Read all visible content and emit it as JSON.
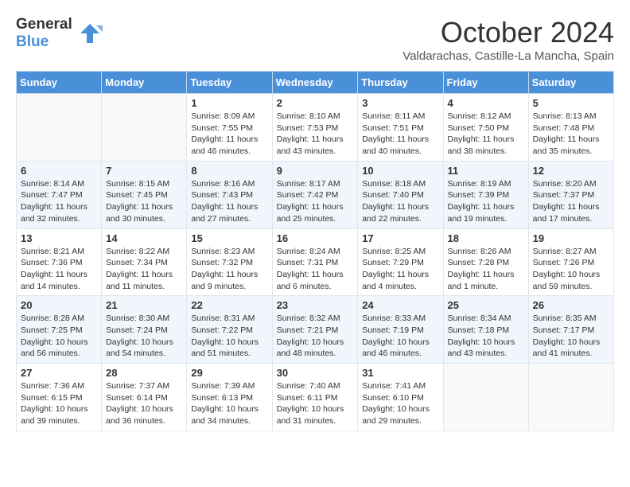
{
  "header": {
    "logo_line1": "General",
    "logo_line2": "Blue",
    "month": "October 2024",
    "location": "Valdarachas, Castille-La Mancha, Spain"
  },
  "weekdays": [
    "Sunday",
    "Monday",
    "Tuesday",
    "Wednesday",
    "Thursday",
    "Friday",
    "Saturday"
  ],
  "weeks": [
    [
      {
        "day": "",
        "info": ""
      },
      {
        "day": "",
        "info": ""
      },
      {
        "day": "1",
        "info": "Sunrise: 8:09 AM\nSunset: 7:55 PM\nDaylight: 11 hours and 46 minutes."
      },
      {
        "day": "2",
        "info": "Sunrise: 8:10 AM\nSunset: 7:53 PM\nDaylight: 11 hours and 43 minutes."
      },
      {
        "day": "3",
        "info": "Sunrise: 8:11 AM\nSunset: 7:51 PM\nDaylight: 11 hours and 40 minutes."
      },
      {
        "day": "4",
        "info": "Sunrise: 8:12 AM\nSunset: 7:50 PM\nDaylight: 11 hours and 38 minutes."
      },
      {
        "day": "5",
        "info": "Sunrise: 8:13 AM\nSunset: 7:48 PM\nDaylight: 11 hours and 35 minutes."
      }
    ],
    [
      {
        "day": "6",
        "info": "Sunrise: 8:14 AM\nSunset: 7:47 PM\nDaylight: 11 hours and 32 minutes."
      },
      {
        "day": "7",
        "info": "Sunrise: 8:15 AM\nSunset: 7:45 PM\nDaylight: 11 hours and 30 minutes."
      },
      {
        "day": "8",
        "info": "Sunrise: 8:16 AM\nSunset: 7:43 PM\nDaylight: 11 hours and 27 minutes."
      },
      {
        "day": "9",
        "info": "Sunrise: 8:17 AM\nSunset: 7:42 PM\nDaylight: 11 hours and 25 minutes."
      },
      {
        "day": "10",
        "info": "Sunrise: 8:18 AM\nSunset: 7:40 PM\nDaylight: 11 hours and 22 minutes."
      },
      {
        "day": "11",
        "info": "Sunrise: 8:19 AM\nSunset: 7:39 PM\nDaylight: 11 hours and 19 minutes."
      },
      {
        "day": "12",
        "info": "Sunrise: 8:20 AM\nSunset: 7:37 PM\nDaylight: 11 hours and 17 minutes."
      }
    ],
    [
      {
        "day": "13",
        "info": "Sunrise: 8:21 AM\nSunset: 7:36 PM\nDaylight: 11 hours and 14 minutes."
      },
      {
        "day": "14",
        "info": "Sunrise: 8:22 AM\nSunset: 7:34 PM\nDaylight: 11 hours and 11 minutes."
      },
      {
        "day": "15",
        "info": "Sunrise: 8:23 AM\nSunset: 7:32 PM\nDaylight: 11 hours and 9 minutes."
      },
      {
        "day": "16",
        "info": "Sunrise: 8:24 AM\nSunset: 7:31 PM\nDaylight: 11 hours and 6 minutes."
      },
      {
        "day": "17",
        "info": "Sunrise: 8:25 AM\nSunset: 7:29 PM\nDaylight: 11 hours and 4 minutes."
      },
      {
        "day": "18",
        "info": "Sunrise: 8:26 AM\nSunset: 7:28 PM\nDaylight: 11 hours and 1 minute."
      },
      {
        "day": "19",
        "info": "Sunrise: 8:27 AM\nSunset: 7:26 PM\nDaylight: 10 hours and 59 minutes."
      }
    ],
    [
      {
        "day": "20",
        "info": "Sunrise: 8:28 AM\nSunset: 7:25 PM\nDaylight: 10 hours and 56 minutes."
      },
      {
        "day": "21",
        "info": "Sunrise: 8:30 AM\nSunset: 7:24 PM\nDaylight: 10 hours and 54 minutes."
      },
      {
        "day": "22",
        "info": "Sunrise: 8:31 AM\nSunset: 7:22 PM\nDaylight: 10 hours and 51 minutes."
      },
      {
        "day": "23",
        "info": "Sunrise: 8:32 AM\nSunset: 7:21 PM\nDaylight: 10 hours and 48 minutes."
      },
      {
        "day": "24",
        "info": "Sunrise: 8:33 AM\nSunset: 7:19 PM\nDaylight: 10 hours and 46 minutes."
      },
      {
        "day": "25",
        "info": "Sunrise: 8:34 AM\nSunset: 7:18 PM\nDaylight: 10 hours and 43 minutes."
      },
      {
        "day": "26",
        "info": "Sunrise: 8:35 AM\nSunset: 7:17 PM\nDaylight: 10 hours and 41 minutes."
      }
    ],
    [
      {
        "day": "27",
        "info": "Sunrise: 7:36 AM\nSunset: 6:15 PM\nDaylight: 10 hours and 39 minutes."
      },
      {
        "day": "28",
        "info": "Sunrise: 7:37 AM\nSunset: 6:14 PM\nDaylight: 10 hours and 36 minutes."
      },
      {
        "day": "29",
        "info": "Sunrise: 7:39 AM\nSunset: 6:13 PM\nDaylight: 10 hours and 34 minutes."
      },
      {
        "day": "30",
        "info": "Sunrise: 7:40 AM\nSunset: 6:11 PM\nDaylight: 10 hours and 31 minutes."
      },
      {
        "day": "31",
        "info": "Sunrise: 7:41 AM\nSunset: 6:10 PM\nDaylight: 10 hours and 29 minutes."
      },
      {
        "day": "",
        "info": ""
      },
      {
        "day": "",
        "info": ""
      }
    ]
  ]
}
